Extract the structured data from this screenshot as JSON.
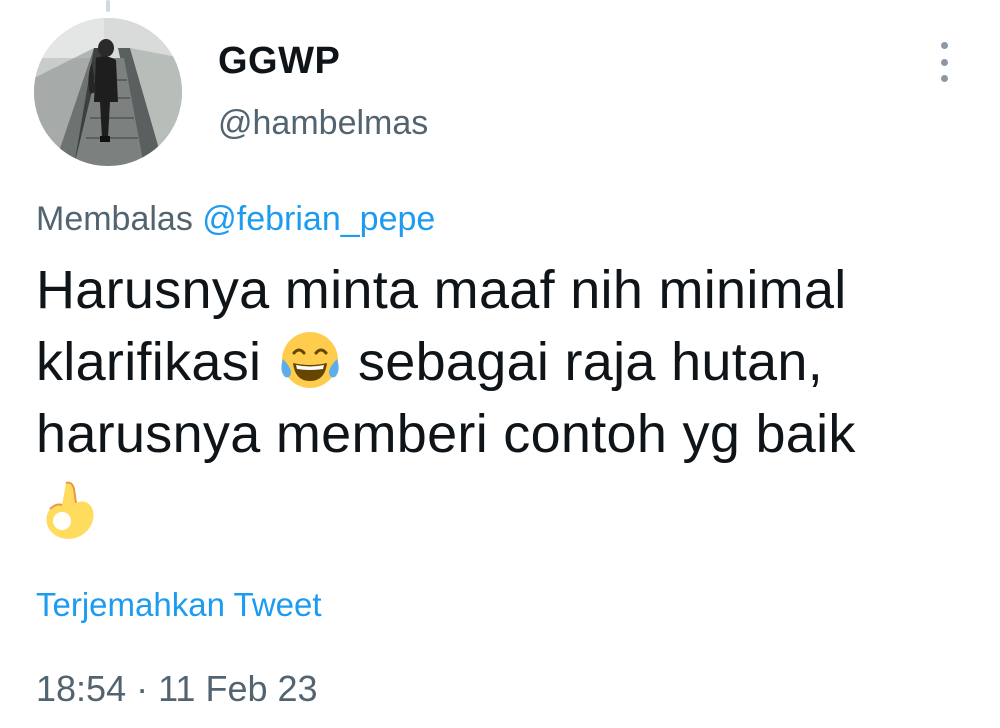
{
  "author": {
    "display_name": "GGWP",
    "handle": "@hambelmas",
    "avatar_icon": "profile-photo-escalator"
  },
  "reply": {
    "prefix": "Membalas ",
    "to_handle": "@febrian_pepe"
  },
  "tweet": {
    "line1": "Harusnya minta maaf nih minimal",
    "line2_part1": "klarifikasi ",
    "emoji1": "face-with-tears-of-joy-emoji",
    "line2_part2": " sebagai raja hutan,",
    "line3": "harusnya memberi contoh yg baik",
    "emoji2": "ok-hand-emoji"
  },
  "translate_label": "Terjemahkan Tweet",
  "timestamp": "18:54 · 11 Feb 23",
  "more_icon": "more-vertical-icon",
  "colors": {
    "text": "#0f1419",
    "secondary": "#536471",
    "link": "#1d9bf0"
  }
}
